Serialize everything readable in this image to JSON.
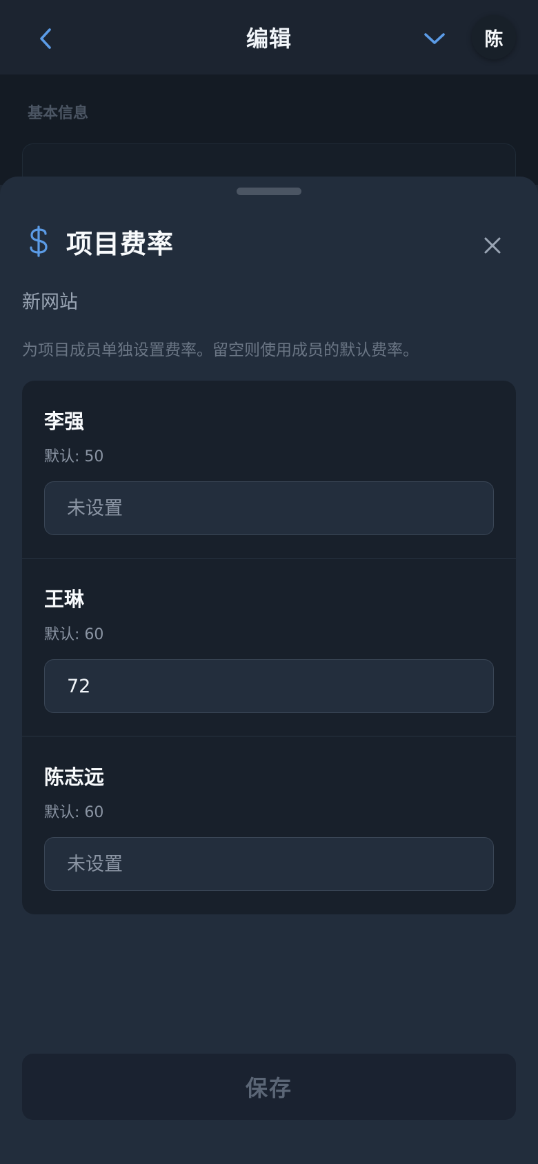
{
  "header": {
    "title": "编辑",
    "avatar_initial": "陈"
  },
  "background": {
    "section_label": "基本信息"
  },
  "sheet": {
    "title": "项目费率",
    "project_name": "新网站",
    "description": "为项目成员单独设置费率。留空则使用成员的默认费率。",
    "members": [
      {
        "name": "李强",
        "default_label": "默认: 50",
        "value": "",
        "placeholder": "未设置"
      },
      {
        "name": "王琳",
        "default_label": "默认: 60",
        "value": "72",
        "placeholder": "未设置"
      },
      {
        "name": "陈志远",
        "default_label": "默认: 60",
        "value": "",
        "placeholder": "未设置"
      }
    ],
    "save_label": "保存"
  },
  "colors": {
    "accent": "#5b9be6",
    "sheet_bg": "#222d3c",
    "card_bg": "#18202b"
  },
  "icons": {
    "back": "chevron-left-icon",
    "expand": "chevron-down-icon",
    "currency": "dollar-icon",
    "close": "close-icon"
  }
}
